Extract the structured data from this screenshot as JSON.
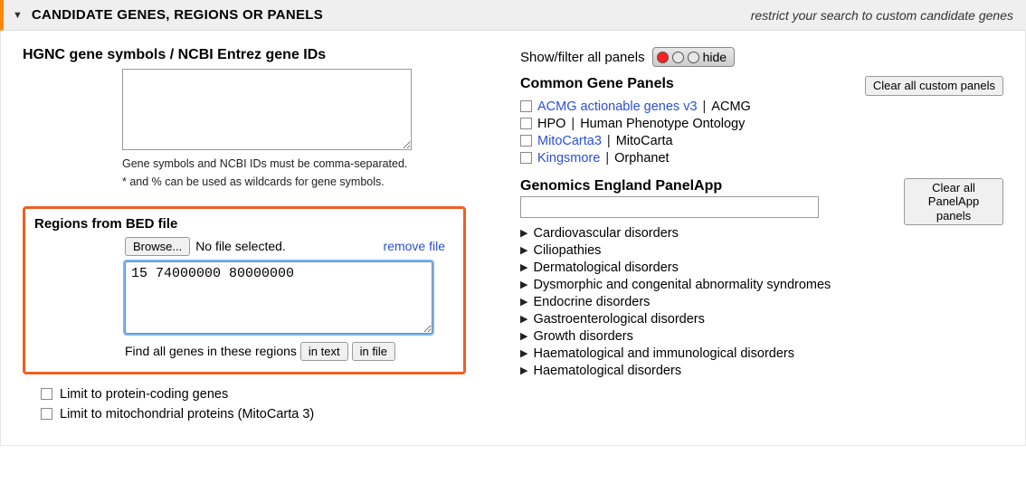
{
  "header": {
    "title": "CANDIDATE GENES, REGIONS OR PANELS",
    "subtitle": "restrict your search to custom candidate genes"
  },
  "gene_symbols": {
    "label": "HGNC gene symbols / NCBI Entrez gene IDs",
    "help1": "Gene symbols and NCBI IDs must be comma-separated.",
    "help2": "* and % can be used as wildcards for gene symbols.",
    "value": ""
  },
  "bed": {
    "label": "Regions from BED file",
    "browse_btn": "Browse...",
    "no_file": "No file selected.",
    "remove": "remove file",
    "text": "15 74000000 80000000",
    "find_label": "Find all genes in these regions",
    "in_text_btn": "in text",
    "in_file_btn": "in file"
  },
  "limit": {
    "protein": "Limit to protein-coding genes",
    "mito": "Limit to mitochondrial proteins (MitoCarta 3)"
  },
  "panels": {
    "showfilter": "Show/filter all panels",
    "hide_btn": "hide",
    "common_head": "Common Gene Panels",
    "clear_custom": "Clear all custom panels",
    "items": [
      {
        "link": "ACMG actionable genes v3",
        "text": "ACMG",
        "linked": true
      },
      {
        "link": "HPO",
        "text": "Human Phenotype Ontology",
        "linked": false
      },
      {
        "link": "MitoCarta3",
        "text": "MitoCarta",
        "linked": true
      },
      {
        "link": "Kingsmore",
        "text": "Orphanet",
        "linked": true
      }
    ],
    "ge_head": "Genomics England PanelApp",
    "clear_panelapp": "Clear all PanelApp panels",
    "ge_items": [
      "Cardiovascular disorders",
      "Ciliopathies",
      "Dermatological disorders",
      "Dysmorphic and congenital abnormality syndromes",
      "Endocrine disorders",
      "Gastroenterological disorders",
      "Growth disorders",
      "Haematological and immunological disorders",
      "Haematological disorders"
    ]
  }
}
